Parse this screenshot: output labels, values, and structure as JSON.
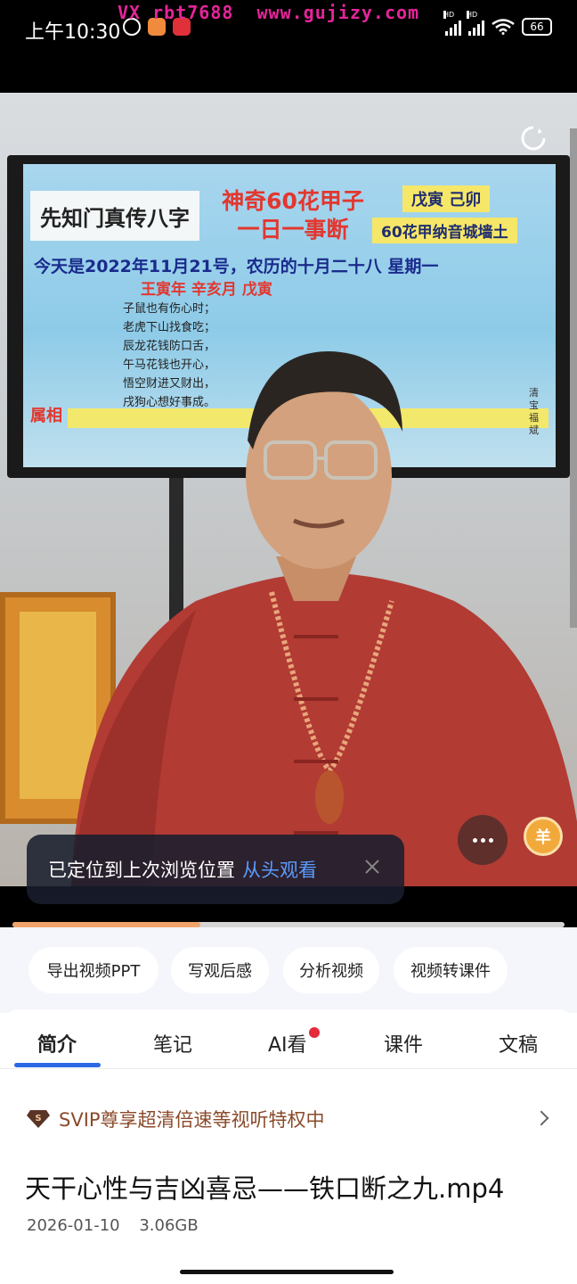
{
  "status_bar": {
    "time": "上午10:30",
    "watermark": "VX rbt7688  www.gujizy.com",
    "battery": "66",
    "hd_label": "HD"
  },
  "video": {
    "slide": {
      "title_box": "先知门真传八字",
      "heading_line1": "神奇60花甲子",
      "heading_line2": "一日一事断",
      "ganzhi": "戊寅  己卯",
      "nayin": "60花甲纳音城墙土",
      "today": "今天是2022年11月21号，农历的十月二十八  星期一",
      "pillars": "王寅年  辛亥月  戊寅",
      "poem": [
        "子鼠也有伤心时；",
        "老虎下山找食吃；",
        "辰龙花钱防口舌，",
        "午马花钱也开心，",
        "悟空财进又财出，",
        "戌狗心想好事成。"
      ],
      "wei_label": "属相",
      "vertical_text": "清宝福斌"
    },
    "progress_fraction": 0.34,
    "coin_icon_glyph": "羊",
    "toast": {
      "message": "已定位到上次浏览位置",
      "link": "从头观看"
    }
  },
  "tools": [
    "导出视频PPT",
    "写观后感",
    "分析视频",
    "视频转课件"
  ],
  "tabs": [
    "简介",
    "笔记",
    "AI看",
    "课件",
    "文稿"
  ],
  "active_tab": "简介",
  "svip": {
    "text": "SVIP尊享超清倍速等视听特权中",
    "badge": "S"
  },
  "file": {
    "title": "天干心性与吉凶喜忌——铁口断之九.mp4",
    "date": "2026-01-10",
    "size": "3.06GB"
  },
  "colors": {
    "accent": "#2c68e6",
    "toast_link": "#5a9cff",
    "progress": "#f0a46a",
    "svip_text": "#8a4a2a",
    "watermark": "#e6249a"
  }
}
